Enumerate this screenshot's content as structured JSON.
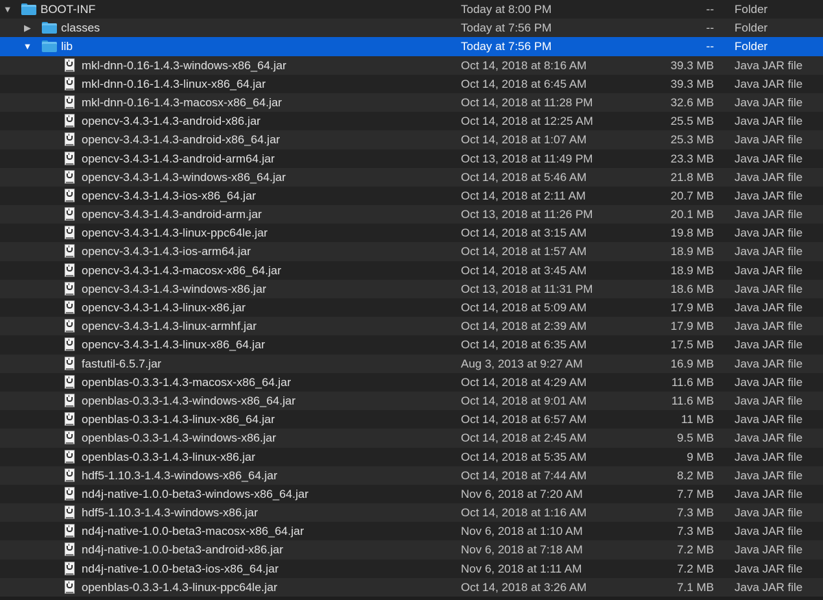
{
  "folders": [
    {
      "name": "BOOT-INF",
      "date": "Today at 8:00 PM",
      "size": "--",
      "kind": "Folder",
      "expanded": true,
      "level": 0
    },
    {
      "name": "classes",
      "date": "Today at 7:56 PM",
      "size": "--",
      "kind": "Folder",
      "expanded": false,
      "level": 1
    },
    {
      "name": "lib",
      "date": "Today at 7:56 PM",
      "size": "--",
      "kind": "Folder",
      "expanded": true,
      "level": 1,
      "selected": true
    }
  ],
  "disclosure": {
    "expanded": "▼",
    "collapsed": "▶"
  },
  "files": [
    {
      "name": "mkl-dnn-0.16-1.4.3-windows-x86_64.jar",
      "date": "Oct 14, 2018 at 8:16 AM",
      "size": "39.3 MB",
      "kind": "Java JAR file"
    },
    {
      "name": "mkl-dnn-0.16-1.4.3-linux-x86_64.jar",
      "date": "Oct 14, 2018 at 6:45 AM",
      "size": "39.3 MB",
      "kind": "Java JAR file"
    },
    {
      "name": "mkl-dnn-0.16-1.4.3-macosx-x86_64.jar",
      "date": "Oct 14, 2018 at 11:28 PM",
      "size": "32.6 MB",
      "kind": "Java JAR file"
    },
    {
      "name": "opencv-3.4.3-1.4.3-android-x86.jar",
      "date": "Oct 14, 2018 at 12:25 AM",
      "size": "25.5 MB",
      "kind": "Java JAR file"
    },
    {
      "name": "opencv-3.4.3-1.4.3-android-x86_64.jar",
      "date": "Oct 14, 2018 at 1:07 AM",
      "size": "25.3 MB",
      "kind": "Java JAR file"
    },
    {
      "name": "opencv-3.4.3-1.4.3-android-arm64.jar",
      "date": "Oct 13, 2018 at 11:49 PM",
      "size": "23.3 MB",
      "kind": "Java JAR file"
    },
    {
      "name": "opencv-3.4.3-1.4.3-windows-x86_64.jar",
      "date": "Oct 14, 2018 at 5:46 AM",
      "size": "21.8 MB",
      "kind": "Java JAR file"
    },
    {
      "name": "opencv-3.4.3-1.4.3-ios-x86_64.jar",
      "date": "Oct 14, 2018 at 2:11 AM",
      "size": "20.7 MB",
      "kind": "Java JAR file"
    },
    {
      "name": "opencv-3.4.3-1.4.3-android-arm.jar",
      "date": "Oct 13, 2018 at 11:26 PM",
      "size": "20.1 MB",
      "kind": "Java JAR file"
    },
    {
      "name": "opencv-3.4.3-1.4.3-linux-ppc64le.jar",
      "date": "Oct 14, 2018 at 3:15 AM",
      "size": "19.8 MB",
      "kind": "Java JAR file"
    },
    {
      "name": "opencv-3.4.3-1.4.3-ios-arm64.jar",
      "date": "Oct 14, 2018 at 1:57 AM",
      "size": "18.9 MB",
      "kind": "Java JAR file"
    },
    {
      "name": "opencv-3.4.3-1.4.3-macosx-x86_64.jar",
      "date": "Oct 14, 2018 at 3:45 AM",
      "size": "18.9 MB",
      "kind": "Java JAR file"
    },
    {
      "name": "opencv-3.4.3-1.4.3-windows-x86.jar",
      "date": "Oct 13, 2018 at 11:31 PM",
      "size": "18.6 MB",
      "kind": "Java JAR file"
    },
    {
      "name": "opencv-3.4.3-1.4.3-linux-x86.jar",
      "date": "Oct 14, 2018 at 5:09 AM",
      "size": "17.9 MB",
      "kind": "Java JAR file"
    },
    {
      "name": "opencv-3.4.3-1.4.3-linux-armhf.jar",
      "date": "Oct 14, 2018 at 2:39 AM",
      "size": "17.9 MB",
      "kind": "Java JAR file"
    },
    {
      "name": "opencv-3.4.3-1.4.3-linux-x86_64.jar",
      "date": "Oct 14, 2018 at 6:35 AM",
      "size": "17.5 MB",
      "kind": "Java JAR file"
    },
    {
      "name": "fastutil-6.5.7.jar",
      "date": "Aug 3, 2013 at 9:27 AM",
      "size": "16.9 MB",
      "kind": "Java JAR file"
    },
    {
      "name": "openblas-0.3.3-1.4.3-macosx-x86_64.jar",
      "date": "Oct 14, 2018 at 4:29 AM",
      "size": "11.6 MB",
      "kind": "Java JAR file"
    },
    {
      "name": "openblas-0.3.3-1.4.3-windows-x86_64.jar",
      "date": "Oct 14, 2018 at 9:01 AM",
      "size": "11.6 MB",
      "kind": "Java JAR file"
    },
    {
      "name": "openblas-0.3.3-1.4.3-linux-x86_64.jar",
      "date": "Oct 14, 2018 at 6:57 AM",
      "size": "11 MB",
      "kind": "Java JAR file"
    },
    {
      "name": "openblas-0.3.3-1.4.3-windows-x86.jar",
      "date": "Oct 14, 2018 at 2:45 AM",
      "size": "9.5 MB",
      "kind": "Java JAR file"
    },
    {
      "name": "openblas-0.3.3-1.4.3-linux-x86.jar",
      "date": "Oct 14, 2018 at 5:35 AM",
      "size": "9 MB",
      "kind": "Java JAR file"
    },
    {
      "name": "hdf5-1.10.3-1.4.3-windows-x86_64.jar",
      "date": "Oct 14, 2018 at 7:44 AM",
      "size": "8.2 MB",
      "kind": "Java JAR file"
    },
    {
      "name": "nd4j-native-1.0.0-beta3-windows-x86_64.jar",
      "date": "Nov 6, 2018 at 7:20 AM",
      "size": "7.7 MB",
      "kind": "Java JAR file"
    },
    {
      "name": "hdf5-1.10.3-1.4.3-windows-x86.jar",
      "date": "Oct 14, 2018 at 1:16 AM",
      "size": "7.3 MB",
      "kind": "Java JAR file"
    },
    {
      "name": "nd4j-native-1.0.0-beta3-macosx-x86_64.jar",
      "date": "Nov 6, 2018 at 1:10 AM",
      "size": "7.3 MB",
      "kind": "Java JAR file"
    },
    {
      "name": "nd4j-native-1.0.0-beta3-android-x86.jar",
      "date": "Nov 6, 2018 at 7:18 AM",
      "size": "7.2 MB",
      "kind": "Java JAR file"
    },
    {
      "name": "nd4j-native-1.0.0-beta3-ios-x86_64.jar",
      "date": "Nov 6, 2018 at 1:11 AM",
      "size": "7.2 MB",
      "kind": "Java JAR file"
    },
    {
      "name": "openblas-0.3.3-1.4.3-linux-ppc64le.jar",
      "date": "Oct 14, 2018 at 3:26 AM",
      "size": "7.1 MB",
      "kind": "Java JAR file"
    }
  ],
  "colors": {
    "background": "#1e1e1e",
    "row_alt": "#2c2c2c",
    "selection": "#0a5fd3",
    "folder": "#3fa7e4"
  },
  "icons": {
    "folder": "folder-icon",
    "file": "jar-file-icon"
  }
}
